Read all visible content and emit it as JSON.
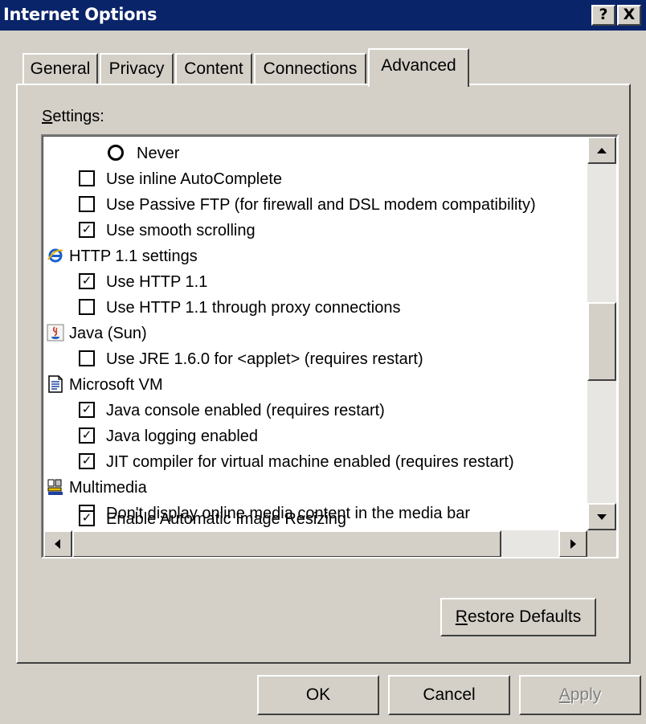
{
  "window": {
    "title": "Internet Options",
    "help_glyph": "?",
    "close_glyph": "X"
  },
  "tabs": [
    {
      "label": "General"
    },
    {
      "label": "Privacy"
    },
    {
      "label": "Content"
    },
    {
      "label": "Connections"
    },
    {
      "label": "Advanced",
      "active": true
    }
  ],
  "settings": {
    "label_mnemonic": "S",
    "label_rest": "ettings:",
    "items": [
      {
        "kind": "radio",
        "text": "Never",
        "checked": false
      },
      {
        "kind": "check",
        "text": "Use inline AutoComplete",
        "checked": false
      },
      {
        "kind": "check",
        "text": "Use Passive FTP (for firewall and DSL modem compatibility)",
        "checked": false
      },
      {
        "kind": "check",
        "text": "Use smooth scrolling",
        "checked": true
      },
      {
        "kind": "category",
        "text": "HTTP 1.1 settings",
        "icon": "ie-icon"
      },
      {
        "kind": "check",
        "text": "Use HTTP 1.1",
        "checked": true
      },
      {
        "kind": "check",
        "text": "Use HTTP 1.1 through proxy connections",
        "checked": false
      },
      {
        "kind": "category",
        "text": "Java (Sun)",
        "icon": "java-icon"
      },
      {
        "kind": "check",
        "text": "Use JRE 1.6.0 for <applet> (requires restart)",
        "checked": false
      },
      {
        "kind": "category",
        "text": "Microsoft VM",
        "icon": "document-icon"
      },
      {
        "kind": "check",
        "text": "Java console enabled (requires restart)",
        "checked": true
      },
      {
        "kind": "check",
        "text": "Java logging enabled",
        "checked": true
      },
      {
        "kind": "check",
        "text": "JIT compiler for virtual machine enabled (requires restart)",
        "checked": true
      },
      {
        "kind": "category",
        "text": "Multimedia",
        "icon": "multimedia-icon"
      },
      {
        "kind": "check",
        "text": "Don't display online media content in the media bar",
        "checked": false
      },
      {
        "kind": "check",
        "text": "Enable Automatic Image Resizing",
        "checked": true
      }
    ]
  },
  "buttons": {
    "restore_mnemonic": "R",
    "restore_rest": "estore Defaults",
    "ok": "OK",
    "cancel": "Cancel",
    "apply_mnemonic": "A",
    "apply_rest": "pply"
  },
  "colors": {
    "titlebar": "#0a246a",
    "face": "#d4d0c8",
    "list_bg": "#ffffff",
    "disabled_text": "#808080"
  },
  "icons": {
    "ie": "ie-icon",
    "java": "java-icon",
    "document": "document-icon",
    "multimedia": "multimedia-icon"
  }
}
